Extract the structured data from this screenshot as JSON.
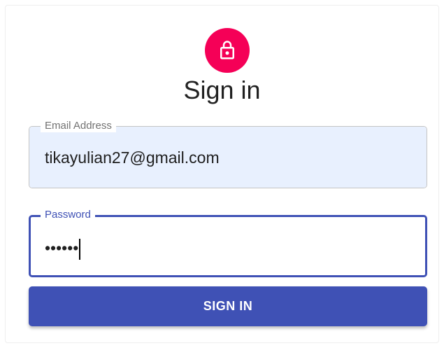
{
  "colors": {
    "avatar_bg": "#f50057",
    "primary": "#3f51b5",
    "autofill_bg": "#e8f0fe"
  },
  "header": {
    "icon": "lock-outline-icon",
    "title": "Sign in"
  },
  "form": {
    "email": {
      "label": "Email Address",
      "value": "tikayulian27@gmail.com"
    },
    "password": {
      "label": "Password",
      "value": "••••••"
    },
    "submit_label": "SIGN IN"
  }
}
